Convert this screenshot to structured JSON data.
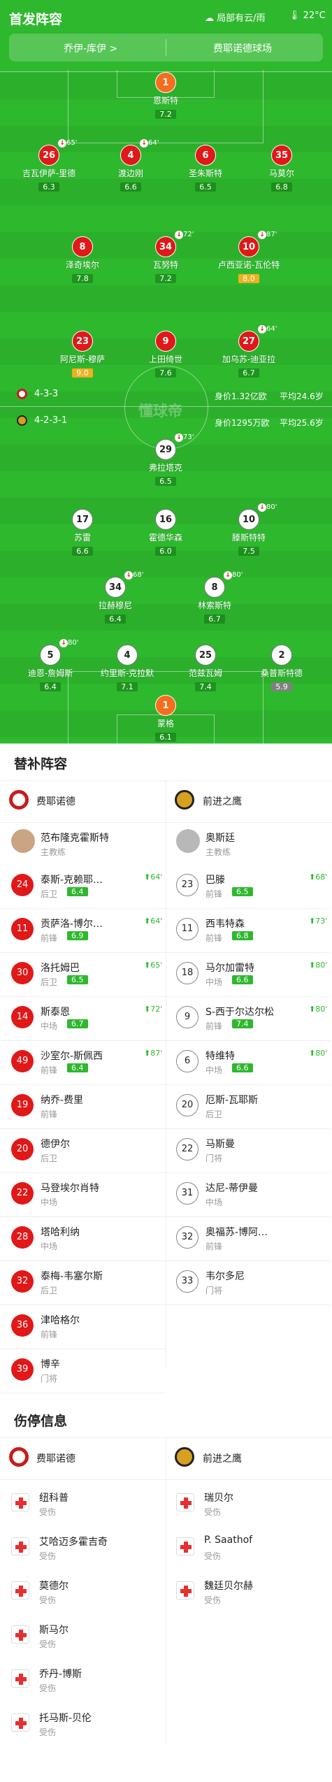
{
  "header": {
    "title": "首发阵容",
    "weather": "局部有云/雨",
    "temp": "22°C"
  },
  "coaches": {
    "home": "乔伊-库伊 >",
    "venue": "费耶诺德球场"
  },
  "home_formation": "4-3-3",
  "home_value": "身价1.32亿欧",
  "home_age": "平均24.6岁",
  "away_formation": "4-2-3-1",
  "away_value": "身价1295万欧",
  "away_age": "平均25.6岁",
  "watermark": "懂球帝",
  "home_players": [
    {
      "n": "1",
      "name": "恩斯特",
      "r": "7.2",
      "gk": true
    },
    {
      "n": "26",
      "name": "吉瓦伊萨-里德",
      "r": "6.3",
      "s": "65'"
    },
    {
      "n": "4",
      "name": "渡边刚",
      "r": "6.6",
      "s": "64'"
    },
    {
      "n": "6",
      "name": "圣朱斯特",
      "r": "6.5"
    },
    {
      "n": "35",
      "name": "马莫尔",
      "r": "6.8"
    },
    {
      "n": "8",
      "name": "泽奇埃尔",
      "r": "7.8"
    },
    {
      "n": "34",
      "name": "瓦努特",
      "r": "7.2",
      "s": "72'"
    },
    {
      "n": "10",
      "name": "卢西亚诺-瓦伦特",
      "r": "8.0",
      "s": "87'",
      "top": true
    },
    {
      "n": "23",
      "name": "阿尼斯-穆萨",
      "r": "9.0",
      "top": true
    },
    {
      "n": "9",
      "name": "上田绮世",
      "r": "7.6"
    },
    {
      "n": "27",
      "name": "加乌苏-迪亚拉",
      "r": "6.7",
      "s": "64'"
    }
  ],
  "away_players": [
    {
      "n": "29",
      "name": "弗拉塔克",
      "r": "6.5",
      "s": "73'"
    },
    {
      "n": "17",
      "name": "苏雷",
      "r": "6.6"
    },
    {
      "n": "16",
      "name": "霍德华森",
      "r": "6.0"
    },
    {
      "n": "10",
      "name": "滕斯特特",
      "r": "7.5",
      "s": "80'"
    },
    {
      "n": "34",
      "name": "拉赫穆尼",
      "r": "6.4",
      "s": "68'"
    },
    {
      "n": "8",
      "name": "林索斯特",
      "r": "6.7",
      "s": "80'"
    },
    {
      "n": "5",
      "name": "迪恩-詹姆斯",
      "r": "6.4",
      "s": "80'"
    },
    {
      "n": "4",
      "name": "约里斯-克拉默",
      "r": "7.1"
    },
    {
      "n": "25",
      "name": "范兹瓦姆",
      "r": "7.4"
    },
    {
      "n": "2",
      "name": "桑普斯特德",
      "r": "5.9",
      "low": true
    },
    {
      "n": "1",
      "name": "蒙格",
      "r": "6.1",
      "gk": true
    }
  ],
  "subs": {
    "title": "替补阵容",
    "home_team": "费耶诺德",
    "away_team": "前进之鹰",
    "home_coach": {
      "name": "范布隆克霍斯特",
      "role": "主教练"
    },
    "away_coach": {
      "name": "奥斯廷",
      "role": "主教练"
    },
    "home": [
      {
        "n": "24",
        "name": "泰斯-克赖耶…",
        "pos": "后卫",
        "r": "6.4",
        "m": "64'"
      },
      {
        "n": "11",
        "name": "贡萨洛-博尔…",
        "pos": "前锋",
        "r": "6.9",
        "m": "64'"
      },
      {
        "n": "30",
        "name": "洛托姆巴",
        "pos": "后卫",
        "r": "6.5",
        "m": "65'"
      },
      {
        "n": "14",
        "name": "斯泰恩",
        "pos": "中场",
        "r": "6.7",
        "m": "72'"
      },
      {
        "n": "49",
        "name": "沙室尔-斯佩西",
        "pos": "前锋",
        "r": "6.4",
        "m": "87'"
      },
      {
        "n": "19",
        "name": "纳乔-费里",
        "pos": "前锋"
      },
      {
        "n": "20",
        "name": "德伊尔",
        "pos": "后卫"
      },
      {
        "n": "22",
        "name": "马登埃尔肖特",
        "pos": "中场"
      },
      {
        "n": "28",
        "name": "塔哈利纳",
        "pos": "中场"
      },
      {
        "n": "32",
        "name": "泰梅-韦塞尔斯",
        "pos": "后卫"
      },
      {
        "n": "36",
        "name": "津哈格尔",
        "pos": "前锋"
      },
      {
        "n": "39",
        "name": "博辛",
        "pos": "门将"
      }
    ],
    "away": [
      {
        "n": "23",
        "name": "巴滕",
        "pos": "前锋",
        "r": "6.5",
        "m": "68'"
      },
      {
        "n": "11",
        "name": "西韦特森",
        "pos": "前锋",
        "r": "6.8",
        "m": "73'"
      },
      {
        "n": "18",
        "name": "马尔加雷特",
        "pos": "中场",
        "r": "6.6",
        "m": "80'"
      },
      {
        "n": "9",
        "name": "S-西于尔达尔松",
        "pos": "前锋",
        "r": "7.4",
        "m": "80'"
      },
      {
        "n": "6",
        "name": "特维特",
        "pos": "中场",
        "r": "6.6",
        "m": "80'"
      },
      {
        "n": "20",
        "name": "厄斯-瓦耶斯",
        "pos": "后卫"
      },
      {
        "n": "22",
        "name": "马斯曼",
        "pos": "门将"
      },
      {
        "n": "31",
        "name": "达尼-蒂伊曼",
        "pos": "中场"
      },
      {
        "n": "32",
        "name": "奥福苏-博阿…",
        "pos": "前锋"
      },
      {
        "n": "33",
        "name": "韦尔多尼",
        "pos": "门将"
      }
    ]
  },
  "injuries": {
    "title": "伤停信息",
    "home_team": "费耶诺德",
    "away_team": "前进之鹰",
    "home": [
      {
        "name": "纽科普",
        "st": "受伤"
      },
      {
        "name": "艾哈迈多霍吉奇",
        "st": "受伤"
      },
      {
        "name": "莫德尔",
        "st": "受伤"
      },
      {
        "name": "斯马尔",
        "st": "受伤"
      },
      {
        "name": "乔丹-博斯",
        "st": "受伤"
      },
      {
        "name": "托马斯-贝伦",
        "st": "受伤"
      }
    ],
    "away": [
      {
        "name": "瑞贝尔",
        "st": "受伤"
      },
      {
        "name": "P. Saathof",
        "st": "受伤"
      },
      {
        "name": "魏廷贝尔赫",
        "st": "受伤"
      }
    ]
  },
  "colors": {
    "pitch": "#2eb82e",
    "home": "#e01818",
    "gold": "#f0b020"
  }
}
